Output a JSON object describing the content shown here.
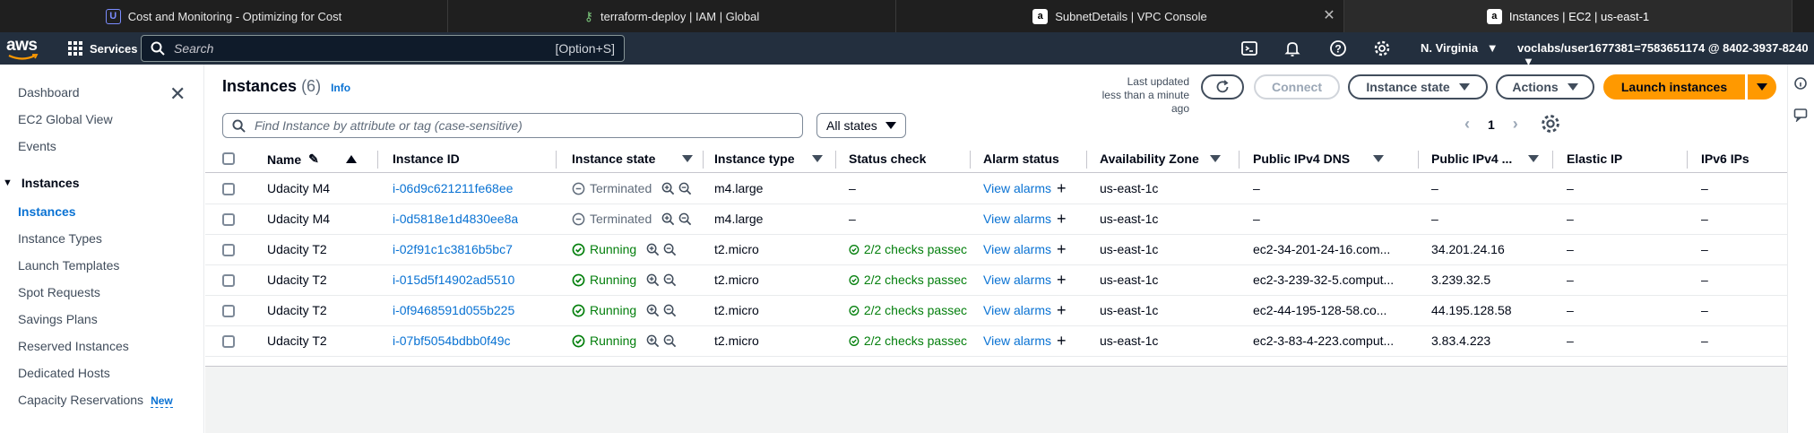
{
  "browser": {
    "tabs": [
      {
        "title": "Cost and Monitoring - Optimizing for Cost",
        "active": false
      },
      {
        "title": "terraform-deploy | IAM | Global",
        "active": false
      },
      {
        "title": "SubnetDetails | VPC Console",
        "active": false
      },
      {
        "title": "Instances | EC2 | us-east-1",
        "active": true
      }
    ]
  },
  "header": {
    "logo": "aws",
    "services_label": "Services",
    "search_placeholder": "Search",
    "search_shortcut": "[Option+S]",
    "region": "N. Virginia",
    "account": "voclabs/user1677381=7583651174 @ 8402-3937-8240"
  },
  "sidebar": {
    "top_links": [
      "Dashboard",
      "EC2 Global View",
      "Events"
    ],
    "section_title": "Instances",
    "items": [
      {
        "label": "Instances",
        "active": true
      },
      {
        "label": "Instance Types"
      },
      {
        "label": "Launch Templates"
      },
      {
        "label": "Spot Requests"
      },
      {
        "label": "Savings Plans"
      },
      {
        "label": "Reserved Instances"
      },
      {
        "label": "Dedicated Hosts"
      },
      {
        "label": "Capacity Reservations",
        "badge": "New"
      }
    ]
  },
  "main": {
    "title": "Instances",
    "count": "(6)",
    "info": "Info",
    "last_updated_line1": "Last updated",
    "last_updated_line2": "less than a minute ago",
    "buttons": {
      "connect": "Connect",
      "instance_state": "Instance state",
      "actions": "Actions",
      "launch": "Launch instances"
    },
    "filter_placeholder": "Find Instance by attribute or tag (case-sensitive)",
    "states_select": "All states",
    "page": "1",
    "columns": [
      "Name",
      "Instance ID",
      "Instance state",
      "Instance type",
      "Status check",
      "Alarm status",
      "Availability Zone",
      "Public IPv4 DNS",
      "Public IPv4 ...",
      "Elastic IP",
      "IPv6 IPs"
    ],
    "rows": [
      {
        "name": "Udacity M4",
        "id": "i-06d9c621211fe68ee",
        "state": "Terminated",
        "type": "m4.large",
        "status": "–",
        "alarm": "View alarms",
        "az": "us-east-1c",
        "dns": "–",
        "ipv4": "–",
        "eip": "–",
        "ipv6": "–"
      },
      {
        "name": "Udacity M4",
        "id": "i-0d5818e1d4830ee8a",
        "state": "Terminated",
        "type": "m4.large",
        "status": "–",
        "alarm": "View alarms",
        "az": "us-east-1c",
        "dns": "–",
        "ipv4": "–",
        "eip": "–",
        "ipv6": "–"
      },
      {
        "name": "Udacity T2",
        "id": "i-02f91c1c3816b5bc7",
        "state": "Running",
        "type": "t2.micro",
        "status": "2/2 checks passec",
        "alarm": "View alarms",
        "az": "us-east-1c",
        "dns": "ec2-34-201-24-16.com...",
        "ipv4": "34.201.24.16",
        "eip": "–",
        "ipv6": "–"
      },
      {
        "name": "Udacity T2",
        "id": "i-015d5f14902ad5510",
        "state": "Running",
        "type": "t2.micro",
        "status": "2/2 checks passec",
        "alarm": "View alarms",
        "az": "us-east-1c",
        "dns": "ec2-3-239-32-5.comput...",
        "ipv4": "3.239.32.5",
        "eip": "–",
        "ipv6": "–"
      },
      {
        "name": "Udacity T2",
        "id": "i-0f9468591d055b225",
        "state": "Running",
        "type": "t2.micro",
        "status": "2/2 checks passec",
        "alarm": "View alarms",
        "az": "us-east-1c",
        "dns": "ec2-44-195-128-58.co...",
        "ipv4": "44.195.128.58",
        "eip": "–",
        "ipv6": "–"
      },
      {
        "name": "Udacity T2",
        "id": "i-07bf5054bdbb0f49c",
        "state": "Running",
        "type": "t2.micro",
        "status": "2/2 checks passec",
        "alarm": "View alarms",
        "az": "us-east-1c",
        "dns": "ec2-3-83-4-223.comput...",
        "ipv4": "3.83.4.223",
        "eip": "–",
        "ipv6": "–"
      }
    ]
  },
  "colors": {
    "accent": "#0972d3",
    "running": "#037f0c",
    "primary_button": "#ff9900",
    "header_bg": "#232f3e"
  }
}
